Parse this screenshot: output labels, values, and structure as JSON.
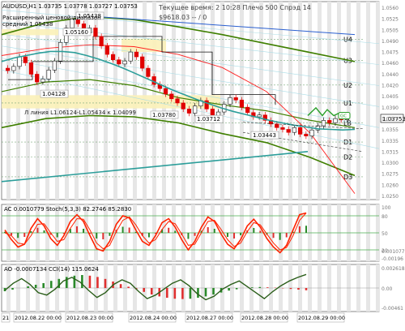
{
  "header": {
    "symbol_line": "AUDUSD,H1  1.03735 1.03778 1.03727 1.03753",
    "time_line": "Текущее время: 2 10:28 Плечо 500 Спрэд 14",
    "balance_line": "$9618.03 -- / 0",
    "range_label_1": "Расширенный ценовой диапазон",
    "range_label_2": "средний 1.05438"
  },
  "colors": {
    "candle_up": "#1a1a1a",
    "candle_down": "#e00000",
    "sma_short": "#2c9e9a",
    "sma_long": "#3f7f00",
    "sma_red": "#ff2020",
    "trend_blue": "#2a5fd0",
    "ac_signal": "#ff2200",
    "green_band": "#5a8a2a"
  },
  "chart_data": [
    {
      "type": "line",
      "title": "AUDUSD,H1",
      "ylim": [
        1.024,
        1.057
      ],
      "right_axis_ticks": [
        "1.0560",
        "1.0525",
        "1.0505",
        "1.0490",
        "1.0475",
        "1.0460",
        "1.0440",
        "1.0420",
        "1.0405",
        "1.0390",
        "1.0375",
        "1.0355",
        "1.0335",
        "1.0315",
        "1.0300",
        "1.0275",
        "1.0260",
        "1.0250"
      ],
      "levels": [
        {
          "name": "U4",
          "value": 1.0507
        },
        {
          "name": "U3",
          "value": 1.0472
        },
        {
          "name": "U2",
          "value": 1.0431
        },
        {
          "name": "U1",
          "value": 1.0401
        },
        {
          "name": "LB",
          "value": 1.0368
        },
        {
          "name": "D1",
          "value": 1.0336
        },
        {
          "name": "D2",
          "value": 1.0311
        },
        {
          "name": "D3",
          "value": 1.0278
        }
      ],
      "price_labels": [
        {
          "text": "1.05438",
          "value": 1.0543
        },
        {
          "text": "1.05160",
          "value": 1.0516
        },
        {
          "text": "1.04128",
          "value": 1.0413
        },
        {
          "text": "1.03780",
          "value": 1.0378
        },
        {
          "text": "1.03712",
          "value": 1.0371
        },
        {
          "text": "1.03443",
          "value": 1.0344
        }
      ],
      "trendline_label": "Л линия L1.06124-L1.05434 к 1.04099",
      "current_price": "1.03753",
      "close_values": [
        1.0455,
        1.0462,
        1.0478,
        1.0468,
        1.0449,
        1.0436,
        1.0441,
        1.0456,
        1.0471,
        1.0502,
        1.0526,
        1.0541,
        1.0533,
        1.0518,
        1.0526,
        1.0512,
        1.0496,
        1.0482,
        1.0473,
        1.0466,
        1.0471,
        1.0486,
        1.0478,
        1.0459,
        1.0445,
        1.0432,
        1.0425,
        1.0416,
        1.0408,
        1.0401,
        1.0391,
        1.0384,
        1.0396,
        1.0405,
        1.0391,
        1.038,
        1.0386,
        1.0399,
        1.041,
        1.0406,
        1.0394,
        1.0385,
        1.0378,
        1.0381,
        1.0372,
        1.0366,
        1.036,
        1.0357,
        1.0352,
        1.036,
        1.0349,
        1.0346,
        1.0356,
        1.0363,
        1.0372,
        1.0368,
        1.0375,
        1.0373,
        1.0375
      ],
      "sma_short": [
        1.047,
        1.0476,
        1.048,
        1.0484,
        1.0487,
        1.0487,
        1.0485,
        1.048,
        1.0474,
        1.0467,
        1.0459,
        1.045,
        1.0441,
        1.0432,
        1.0423,
        1.0415,
        1.0407,
        1.04,
        1.0393,
        1.0387,
        1.0382,
        1.0377,
        1.0372,
        1.0368,
        1.0364,
        1.0361,
        1.0358,
        1.0357,
        1.0356,
        1.0357
      ],
      "sma_long": [
        1.0452,
        1.0461,
        1.047,
        1.0477,
        1.0482,
        1.0485,
        1.0487,
        1.0487,
        1.0486,
        1.0483,
        1.048,
        1.0475,
        1.047,
        1.0464,
        1.0457,
        1.045,
        1.0443,
        1.0436,
        1.043,
        1.0424,
        1.0418,
        1.0413,
        1.0408,
        1.0404,
        1.04,
        1.0397,
        1.0394,
        1.0392,
        1.039,
        1.0389
      ],
      "x_labels": [
        "21",
        "2012.08.22 00:00",
        "2012.08.23 00:00",
        "2012.08.24 00:00",
        "2012.08.27 00:00",
        "2012.08.28 00:00",
        "2012.08.29 00:00"
      ]
    },
    {
      "type": "line",
      "title": "AC 0.0010779  Stoch(5,3,3) 82.2746 85.2830",
      "ylim": [
        0,
        100
      ],
      "right_axis_ticks": [
        "100",
        "80",
        "50",
        "20",
        "0.0010779",
        "-0.00196"
      ],
      "stoch_main": [
        55,
        38,
        25,
        30,
        58,
        75,
        62,
        40,
        28,
        45,
        70,
        82,
        70,
        45,
        22,
        18,
        35,
        65,
        80,
        76,
        55,
        35,
        28,
        45,
        68,
        75,
        60,
        38,
        20,
        35,
        60,
        78,
        70,
        48,
        30,
        22,
        38,
        62,
        74,
        60,
        40,
        25,
        15,
        28,
        55,
        82,
        85
      ],
      "stoch_signal": [
        50,
        45,
        32,
        30,
        45,
        65,
        66,
        50,
        35,
        38,
        58,
        75,
        74,
        55,
        32,
        22,
        28,
        52,
        72,
        78,
        64,
        45,
        32,
        38,
        56,
        70,
        66,
        48,
        28,
        30,
        50,
        70,
        72,
        56,
        38,
        26,
        32,
        52,
        68,
        64,
        48,
        32,
        20,
        24,
        45,
        72,
        85
      ]
    },
    {
      "type": "bar",
      "title": "AO -0.0007134 CCI(14) 115.0624",
      "ylim": [
        -200,
        200
      ],
      "right_axis_ticks": [
        "0.0026183",
        "0.00",
        "-0.00461"
      ],
      "cci": [
        -20,
        40,
        80,
        30,
        -40,
        -60,
        -10,
        60,
        90,
        50,
        -20,
        -80,
        -40,
        30,
        70,
        40,
        -30,
        -90,
        -60,
        -10,
        40,
        70,
        20,
        -50,
        -100,
        -70,
        -10,
        30,
        60,
        10,
        -40,
        -90,
        -30,
        20,
        60,
        90,
        115
      ],
      "ao": [
        -10,
        -5,
        0,
        5,
        10,
        15,
        22,
        28,
        34,
        38,
        40,
        38,
        34,
        28,
        20,
        12,
        4,
        -4,
        -12,
        -20,
        -26,
        -30,
        -33,
        -34,
        -33,
        -30,
        -26,
        -20,
        -14,
        -8,
        -4,
        0,
        2,
        3,
        2,
        1,
        -1,
        -3,
        -5,
        -7
      ]
    }
  ]
}
